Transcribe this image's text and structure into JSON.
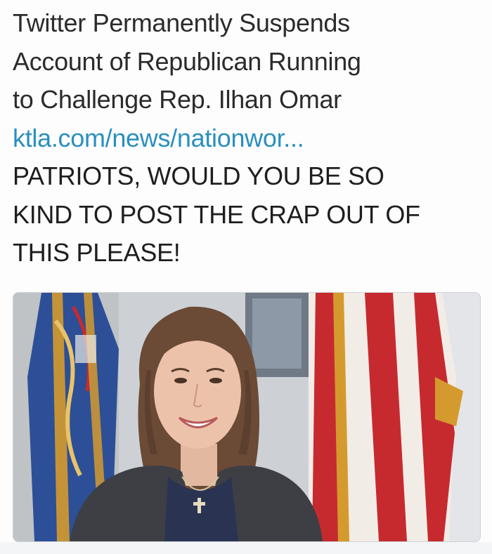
{
  "post": {
    "headline_lines": [
      "Twitter Permanently Suspends",
      "Account of Republican Running",
      "to Challenge Rep. Ilhan Omar"
    ],
    "link_text": "ktla.com/news/nationwor...",
    "caption_lines": [
      "PATRIOTS, WOULD YOU BE SO",
      "KIND TO POST THE CRAP OUT OF",
      "THIS PLEASE!"
    ]
  },
  "photo": {
    "subject": "smiling-woman-with-flags-photo",
    "colors": {
      "flag_red": "#c62a2f",
      "flag_blue": "#2c4f97",
      "fringe_gold": "#d59a2e",
      "jacket": "#3d3f45",
      "shirt": "#2a3452",
      "hair": "#6b4a36",
      "wall": "#cfd3d8"
    }
  }
}
